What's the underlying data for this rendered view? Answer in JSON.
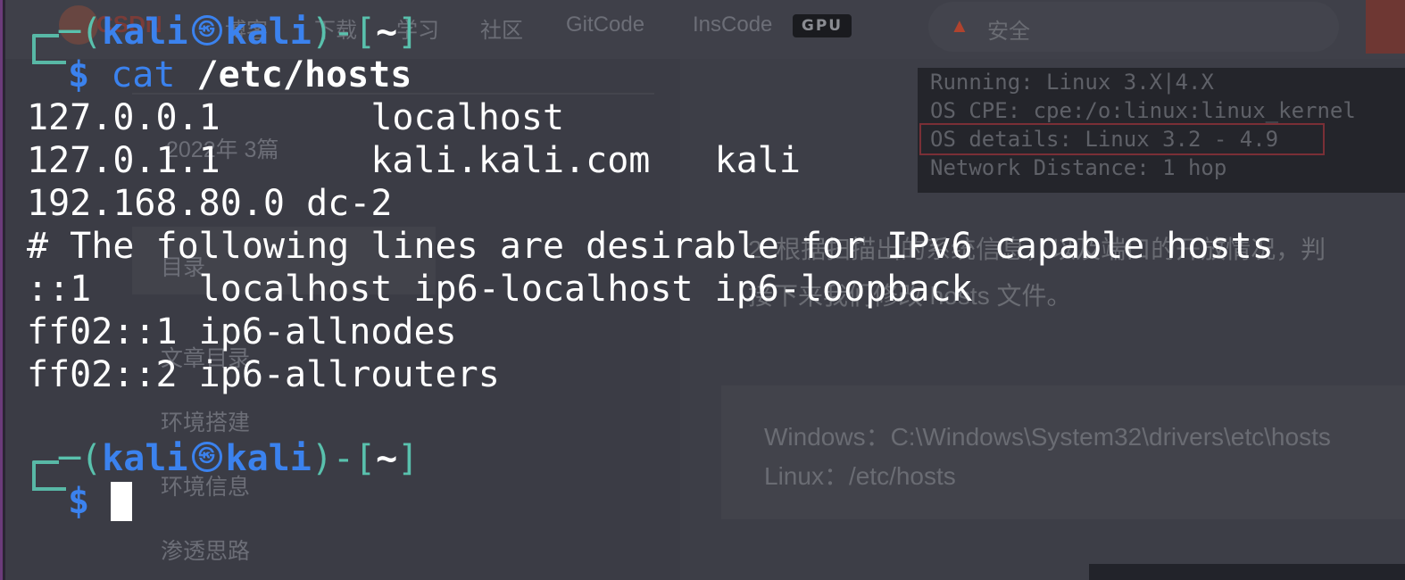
{
  "background_page": {
    "header": {
      "logo_text": "CSDN",
      "nav_items": [
        "博客",
        "下载",
        "学习",
        "社区",
        "GitCode",
        "InsCode"
      ],
      "gpu_badge": "GPU",
      "search_placeholder": "安全"
    },
    "sidebar": {
      "archive": "2022年  3篇",
      "toc_title": "目录",
      "toc_items": [
        "文章目录",
        "环境搭建",
        "环境信息",
        "渗透思路"
      ]
    },
    "article": {
      "nmap_lines": [
        "Running: Linux 3.X|4.X",
        "OS CPE: cpe:/o:linux:linux_kernel",
        "OS details: Linux 3.2 - 4.9",
        "Network Distance: 1 hop"
      ],
      "para_line1": "2. 根据扫描出的系统信息，以及端口的开放情况，判",
      "para_line2": "    接下来我们修改 hosts 文件。",
      "code_lines": [
        "Windows：C:\\Windows\\System32\\drivers\\etc\\hosts",
        "Linux：/etc/hosts"
      ]
    }
  },
  "terminal": {
    "prompt": {
      "user": "kali",
      "host": "kali",
      "at_symbol": "㉿",
      "dir": "~",
      "symbol": "$"
    },
    "command": {
      "name": "cat",
      "arg": "/etc/hosts"
    },
    "output_lines": [
      "127.0.0.1       localhost",
      "127.0.1.1       kali.kali.com   kali",
      "192.168.80.0 dc-2",
      "# The following lines are desirable for IPv6 capable hosts",
      "::1     localhost ip6-localhost ip6-loopback",
      "ff02::1 ip6-allnodes",
      "ff02::2 ip6-allrouters"
    ]
  },
  "colors": {
    "teal": "#59c1ad",
    "blue": "#3b82ee",
    "terminal_bg": "#3b3c45"
  }
}
